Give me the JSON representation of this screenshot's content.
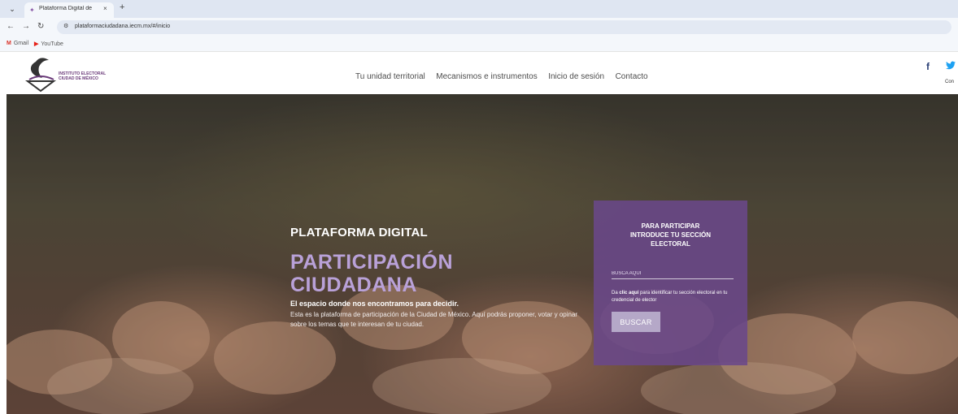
{
  "browser": {
    "tab_title": "Plataforma Digital de Participa",
    "tab_close": "×",
    "new_tab": "+",
    "url": "plataformaciudadana.iecm.mx/#/inicio",
    "bookmarks": [
      {
        "label": "Gmail",
        "icon": "gmail-icon"
      },
      {
        "label": "YouTube",
        "icon": "youtube-icon"
      }
    ]
  },
  "header": {
    "logo_line1": "INSTITUTO ELECTORAL",
    "logo_line2": "CIUDAD DE MÉXICO",
    "nav": [
      "Tu unidad territorial",
      "Mecanismos e instrumentos",
      "Inicio de sesión",
      "Contacto"
    ],
    "social": {
      "facebook": "f",
      "twitter": "🐦"
    },
    "contact_snippet": "Con"
  },
  "hero": {
    "kicker": "PLATAFORMA DIGITAL",
    "title_line1": "PARTICIPACIÓN",
    "title_line2": "CIUDADANA",
    "lead": "El espacio donde nos encontramos para decidir.",
    "description": "Esta es la plataforma de participación de la Ciudad de México. Aquí podrás proponer, votar y opinar sobre los temas que te interesan de tu ciudad."
  },
  "panel": {
    "title_line1": "PARA PARTICIPAR",
    "title_line2": "INTRODUCE TU SECCIÓN",
    "title_line3": "ELECTORAL",
    "input_placeholder": "BUSCA AQUÍ",
    "help_prefix": "Da ",
    "help_link": "clic aquí",
    "help_suffix": " para identificar tu sección electoral en tu credencial de elector",
    "button_label": "BUSCAR"
  },
  "colors": {
    "accent_purple": "#6a488a",
    "title_lavender": "#b9a1d8",
    "button_muted": "#b5a8c8"
  }
}
